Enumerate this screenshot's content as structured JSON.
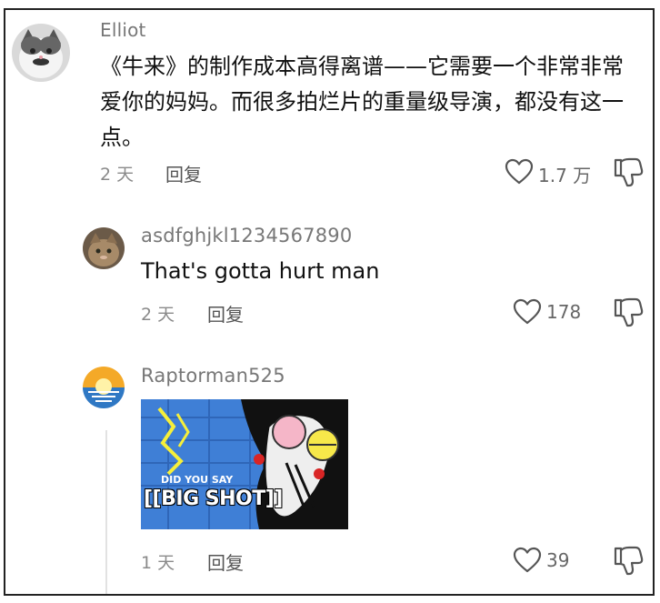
{
  "comments": [
    {
      "username": "Elliot",
      "text": "《牛来》的制作成本高得离谱——它需要一个非常非常爱你的妈妈。而很多拍烂片的重量级导演，都没有这一点。",
      "time": "2 天",
      "reply_label": "回复",
      "like_count": "1.7 万",
      "avatar_icon": "cat-avatar-icon"
    },
    {
      "username": "asdfghjkl1234567890",
      "text": "That's gotta hurt man",
      "time": "2 天",
      "reply_label": "回复",
      "like_count": "178",
      "avatar_icon": "cat-photo-avatar-icon"
    },
    {
      "username": "Raptorman525",
      "time": "1 天",
      "reply_label": "回复",
      "like_count": "39",
      "avatar_icon": "sunset-avatar-icon",
      "image": {
        "caption_small": "DID YOU SAY",
        "caption_big": "[[BIG SHOT]]"
      }
    }
  ],
  "colors": {
    "username": "#777777",
    "meta": "#8a8a8a",
    "meme_bg": "#3f7fd6",
    "meme_caption": "#ffffff"
  }
}
